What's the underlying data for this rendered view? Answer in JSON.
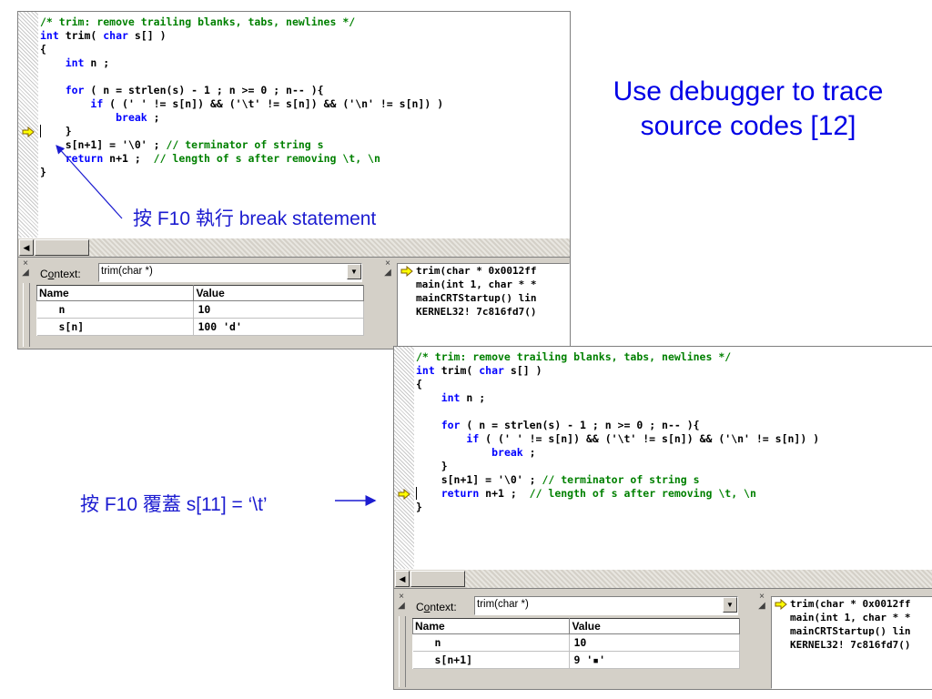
{
  "title": "Use debugger to trace source codes [12]",
  "annotations": {
    "note1": "按 F10 執行 break statement",
    "note2": "按 F10 覆蓋 s[11] = ‘\\t’"
  },
  "code_lines": [
    {
      "parts": [
        {
          "t": "/* trim: remove trailing blanks, tabs, newlines */",
          "c": "c"
        }
      ]
    },
    {
      "parts": [
        {
          "t": "int",
          "c": "k"
        },
        {
          "t": " trim( "
        },
        {
          "t": "char",
          "c": "k"
        },
        {
          "t": " s[] )"
        }
      ]
    },
    {
      "parts": [
        {
          "t": "{"
        }
      ]
    },
    {
      "parts": [
        {
          "t": "    "
        },
        {
          "t": "int",
          "c": "k"
        },
        {
          "t": " n ;"
        }
      ]
    },
    {
      "parts": [
        {
          "t": ""
        }
      ]
    },
    {
      "parts": [
        {
          "t": "    "
        },
        {
          "t": "for",
          "c": "k"
        },
        {
          "t": " ( n = strlen(s) - 1 ; n >= 0 ; n-- ){"
        }
      ]
    },
    {
      "parts": [
        {
          "t": "        "
        },
        {
          "t": "if",
          "c": "k"
        },
        {
          "t": " ( (' ' != s[n]) && ('\\t' != s[n]) && ('\\n' != s[n]) )"
        }
      ]
    },
    {
      "parts": [
        {
          "t": "            "
        },
        {
          "t": "break",
          "c": "k"
        },
        {
          "t": " ;"
        }
      ]
    },
    {
      "parts": [
        {
          "t": "    }"
        }
      ]
    },
    {
      "parts": [
        {
          "t": "    s[n+1] = '\\0' ; "
        },
        {
          "t": "// terminator of string s",
          "c": "c"
        }
      ]
    },
    {
      "parts": [
        {
          "t": "    "
        },
        {
          "t": "return",
          "c": "k"
        },
        {
          "t": " n+1 ;  "
        },
        {
          "t": "// length of s after removing \\t, \\n",
          "c": "c"
        }
      ]
    },
    {
      "parts": [
        {
          "t": "}"
        }
      ]
    }
  ],
  "panels": [
    {
      "current_line": 8,
      "context_label_pre": "C",
      "context_label_u": "o",
      "context_label_post": "ntext:",
      "context_value": "trim(char *)",
      "columns": [
        "Name",
        "Value"
      ],
      "rows": [
        {
          "name": "n",
          "value": "10"
        },
        {
          "name": "s[n]",
          "value": "100 'd'"
        }
      ],
      "call_stack": [
        "trim(char * 0x0012ff",
        "main(int 1, char * *",
        "mainCRTStartup() lin",
        "KERNEL32! 7c816fd7()"
      ]
    },
    {
      "current_line": 10,
      "context_label_pre": "C",
      "context_label_u": "o",
      "context_label_post": "ntext:",
      "context_value": "trim(char *)",
      "columns": [
        "Name",
        "Value"
      ],
      "rows": [
        {
          "name": "n",
          "value": "10"
        },
        {
          "name": "s[n+1]",
          "value": "9 '▪'"
        }
      ],
      "call_stack": [
        "trim(char * 0x0012ff",
        "main(int 1, char * *",
        "mainCRTStartup() lin",
        "KERNEL32! 7c816fd7()"
      ]
    }
  ],
  "colors": {
    "title": "#0000e6",
    "annotation": "#1c1cd0",
    "comment": "#008000",
    "keyword": "#0000ff",
    "arrow": "#ffff00"
  },
  "icons": [
    "current-line-arrow-icon",
    "close-icon",
    "dropdown-arrow-icon",
    "scroll-left-icon"
  ]
}
